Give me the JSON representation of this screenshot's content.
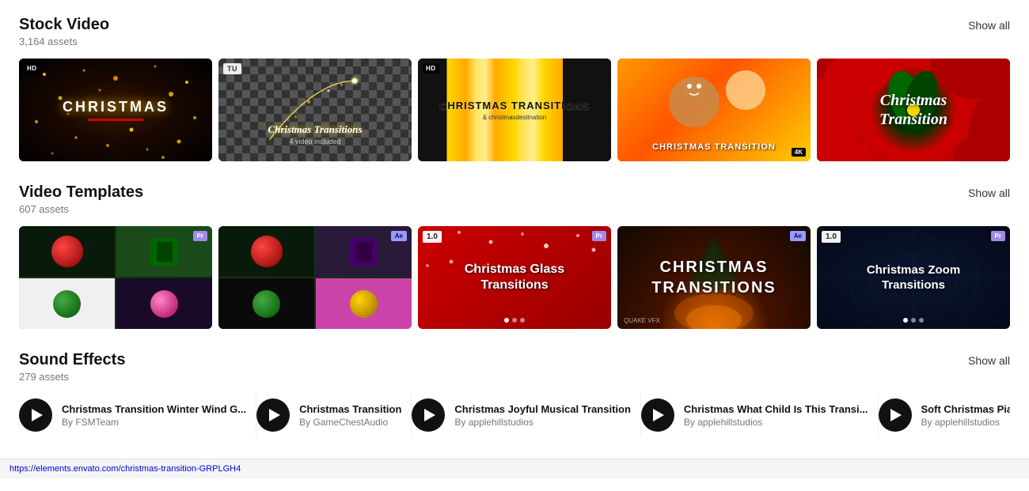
{
  "sections": {
    "stock_video": {
      "title": "Stock Video",
      "count": "3,164 assets",
      "show_all": "Show all",
      "cards": [
        {
          "id": "sv1",
          "type": "golden-particles",
          "label": "CHRISTMAS",
          "sublabel": "",
          "badge": "HD",
          "badge_type": "hd"
        },
        {
          "id": "sv2",
          "type": "checker-star",
          "label": "Christmas Transitions",
          "sublabel": "4 video included",
          "badge": "TU",
          "badge_type": "tu"
        },
        {
          "id": "sv3",
          "type": "gold-bars",
          "label": "CHRISTMAS TRANSITIONS",
          "sublabel": "& christmasdestination",
          "badge": "HD",
          "badge_type": "hd"
        },
        {
          "id": "sv4",
          "type": "stickers",
          "label": "CHRISTMAS TRANSITION",
          "badge4k": "4K"
        },
        {
          "id": "sv5",
          "type": "poinsettia",
          "label": "Christmas Transition"
        }
      ]
    },
    "video_templates": {
      "title": "Video Templates",
      "count": "607 assets",
      "show_all": "Show all",
      "cards": [
        {
          "id": "vt1",
          "type": "ornament-grid",
          "badge_sw": "Pr",
          "badge_sw_color": "pr"
        },
        {
          "id": "vt2",
          "type": "ornament-grid",
          "badge_sw": "Ae",
          "badge_sw_color": "ae"
        },
        {
          "id": "vt3",
          "type": "glass-transitions",
          "label": "Christmas Glass Transitions",
          "version": "1.0",
          "badge_sw": "Pr",
          "badge_sw_color": "pr",
          "bg_color": "red"
        },
        {
          "id": "vt4",
          "type": "christmas-transitions",
          "label": "CHRISTMAS TRANSITIONS",
          "badge_sw": "Ae",
          "badge_sw_color": "ae",
          "bg_color": "fireplace"
        },
        {
          "id": "vt5",
          "type": "zoom-transitions",
          "label": "Christmas Zoom Transitions",
          "version": "1.0",
          "badge_sw": "Pr",
          "badge_sw_color": "pr",
          "bg_color": "dark-blue"
        }
      ]
    },
    "sound_effects": {
      "title": "Sound Effects",
      "count": "279 assets",
      "show_all": "Show all",
      "items": [
        {
          "id": "se1",
          "title": "Christmas Transition Winter Wind G...",
          "author": "By FSMTeam"
        },
        {
          "id": "se2",
          "title": "Christmas Transition",
          "author": "By GameChestAudio"
        },
        {
          "id": "se3",
          "title": "Christmas Joyful Musical Transition",
          "author": "By applehillstudios"
        },
        {
          "id": "se4",
          "title": "Christmas What Child Is This Transi...",
          "author": "By applehillstudios"
        },
        {
          "id": "se5",
          "title": "Soft Christmas Piano Transition",
          "author": "By applehillstudios"
        }
      ]
    }
  },
  "status_bar": {
    "url": "https://elements.envato.com/christmas-transition-GRPLGH4"
  }
}
